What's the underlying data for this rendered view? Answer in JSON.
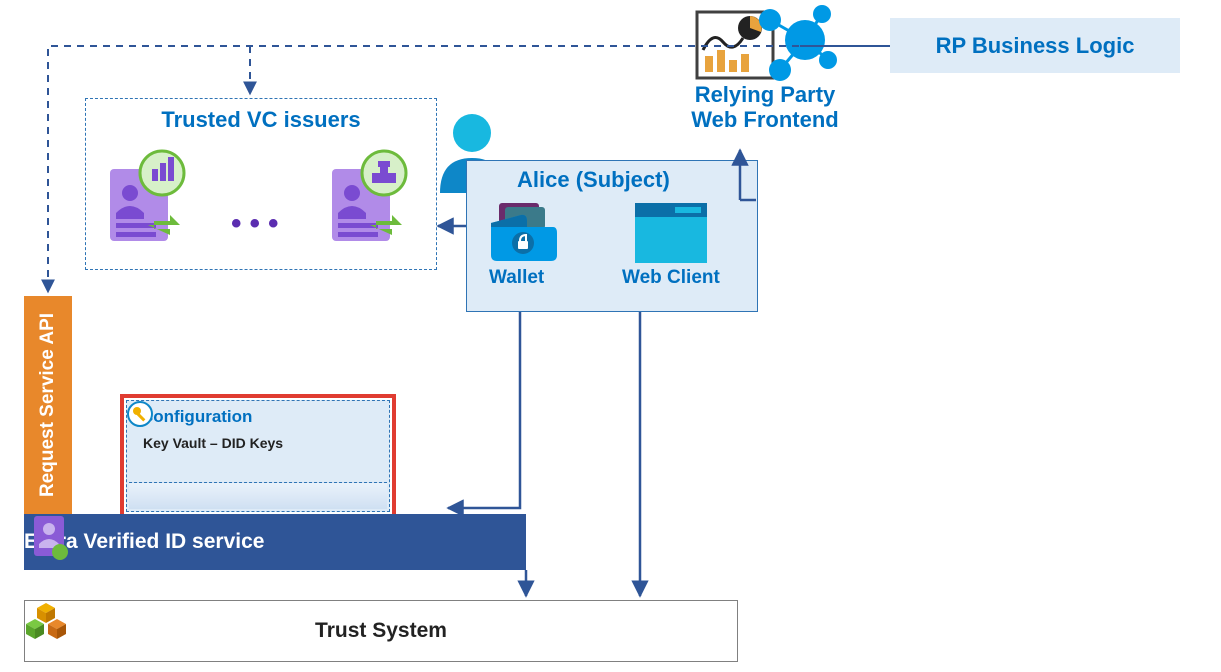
{
  "rpBusinessLogic": {
    "label": "RP Business Logic"
  },
  "relyingParty": {
    "line1": "Relying Party",
    "line2": "Web Frontend"
  },
  "trustedIssuers": {
    "title": "Trusted VC issuers"
  },
  "alice": {
    "title": "Alice (Subject)",
    "wallet": "Wallet",
    "webClient": "Web Client"
  },
  "config": {
    "title": "Configuration",
    "keyVault": "Key Vault – DID Keys"
  },
  "requestApi": {
    "label": "Request Service API"
  },
  "entra": {
    "label": "Entra Verified ID service"
  },
  "trust": {
    "label": "Trust System"
  },
  "icons": {
    "chart": "chart-icon",
    "graph": "graph-icon",
    "person": "person-icon",
    "card1": "vc-card-icon",
    "card2": "vc-card-icon",
    "factory": "factory-icon",
    "gov": "gov-building-icon",
    "wallet": "wallet-icon",
    "browser": "browser-icon",
    "azure": "azure-icon",
    "key": "key-icon",
    "badge": "id-badge-icon",
    "cubes": "cubes-icon",
    "dots": "ellipsis-icon"
  }
}
